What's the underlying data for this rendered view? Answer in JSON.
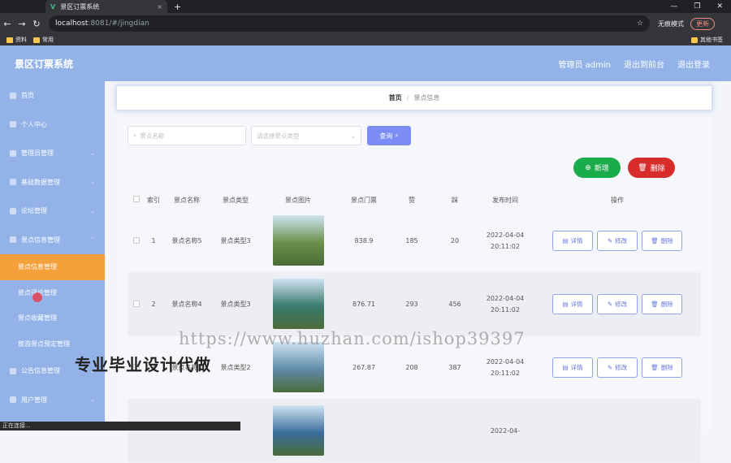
{
  "browser": {
    "tab_title": "景区订票系统",
    "tab_close": "×",
    "new_tab": "+",
    "url_host": "localhost",
    "url_path": ":8081/#/jingdian",
    "incognito": "无痕模式",
    "update": "更新",
    "bookmarks": [
      "资料",
      "常用"
    ],
    "other_bookmarks": "其他书签",
    "status_text": "正在连接..."
  },
  "header": {
    "title": "景区订票系统",
    "user": "管理员 admin",
    "to_front": "退出到前台",
    "logout": "退出登录"
  },
  "sidebar": {
    "items": [
      {
        "label": "首页",
        "icon": "home-icon"
      },
      {
        "label": "个人中心",
        "icon": "user-icon"
      },
      {
        "label": "管理员管理",
        "icon": "admin-icon",
        "chevron": true
      },
      {
        "label": "基础数据管理",
        "icon": "data-icon",
        "chevron": true
      },
      {
        "label": "论坛管理",
        "icon": "forum-icon",
        "chevron": true
      },
      {
        "label": "景点信息管理",
        "icon": "scenic-icon",
        "chevron": true
      }
    ],
    "sub_items": [
      "景点信息管理",
      "景点评论管理",
      "景点收藏管理",
      "旅游景点预定管理"
    ],
    "items_after": [
      {
        "label": "公告信息管理",
        "icon": "notice-icon",
        "chevron": true
      },
      {
        "label": "用户管理",
        "icon": "users-icon",
        "chevron": true
      }
    ]
  },
  "breadcrumb": {
    "home": "首页",
    "sep": "/",
    "current": "景点信息"
  },
  "search": {
    "name_placeholder": "景点名称",
    "type_placeholder": "请选择景点类型",
    "button": "查询"
  },
  "actions": {
    "add": "新增",
    "delete": "删除"
  },
  "table": {
    "headers": [
      "索引",
      "景点名称",
      "景点类型",
      "景点图片",
      "景点门票",
      "赞",
      "踩",
      "发布时间",
      "操作"
    ],
    "rows": [
      {
        "index": "1",
        "name": "景点名称5",
        "type": "景点类型3",
        "price": "838.9",
        "up": "185",
        "down": "20",
        "time": "2022-04-04 20:11:02",
        "img_color": "#6a8f4a"
      },
      {
        "index": "2",
        "name": "景点名称4",
        "type": "景点类型3",
        "price": "876.71",
        "up": "293",
        "down": "456",
        "time": "2022-04-04 20:11:02",
        "img_color": "#3b7a6d"
      },
      {
        "index": "3",
        "name": "景点名称3",
        "type": "景点类型2",
        "price": "267.87",
        "up": "208",
        "down": "387",
        "time": "2022-04-04 20:11:02",
        "img_color": "#5e8aa8"
      },
      {
        "index": "",
        "name": "",
        "type": "",
        "price": "",
        "up": "",
        "down": "",
        "time": "2022-04-",
        "img_color": "#3a6d9a"
      }
    ],
    "op_detail": "详情",
    "op_edit": "修改",
    "op_delete": "删除"
  },
  "watermark": {
    "url": "https://www.huzhan.com/ishop39397",
    "text": "专业毕业设计代做"
  }
}
